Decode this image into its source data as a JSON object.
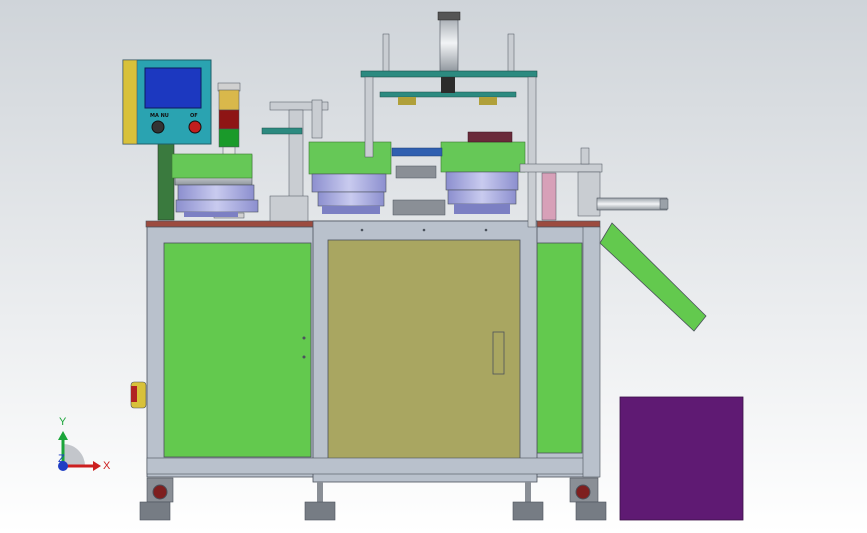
{
  "viewport": {
    "background_top": "#cfd4d9",
    "background_bottom": "#ffffff"
  },
  "control_panel": {
    "switch_label": "MA  NU",
    "button_label": "OF"
  },
  "triad": {
    "x_label": "X",
    "y_label": "Y",
    "z_label": "Z"
  },
  "colors": {
    "frame": "#b9c1cc",
    "frame_edge": "#4b525c",
    "green_panel": "#63c94e",
    "door_panel": "#a9a661",
    "purple_bin": "#5f1a73",
    "tabletop": "#9c4b3f",
    "panel_cyan": "#2aa3b1",
    "screen_blue": "#1c38c0"
  }
}
